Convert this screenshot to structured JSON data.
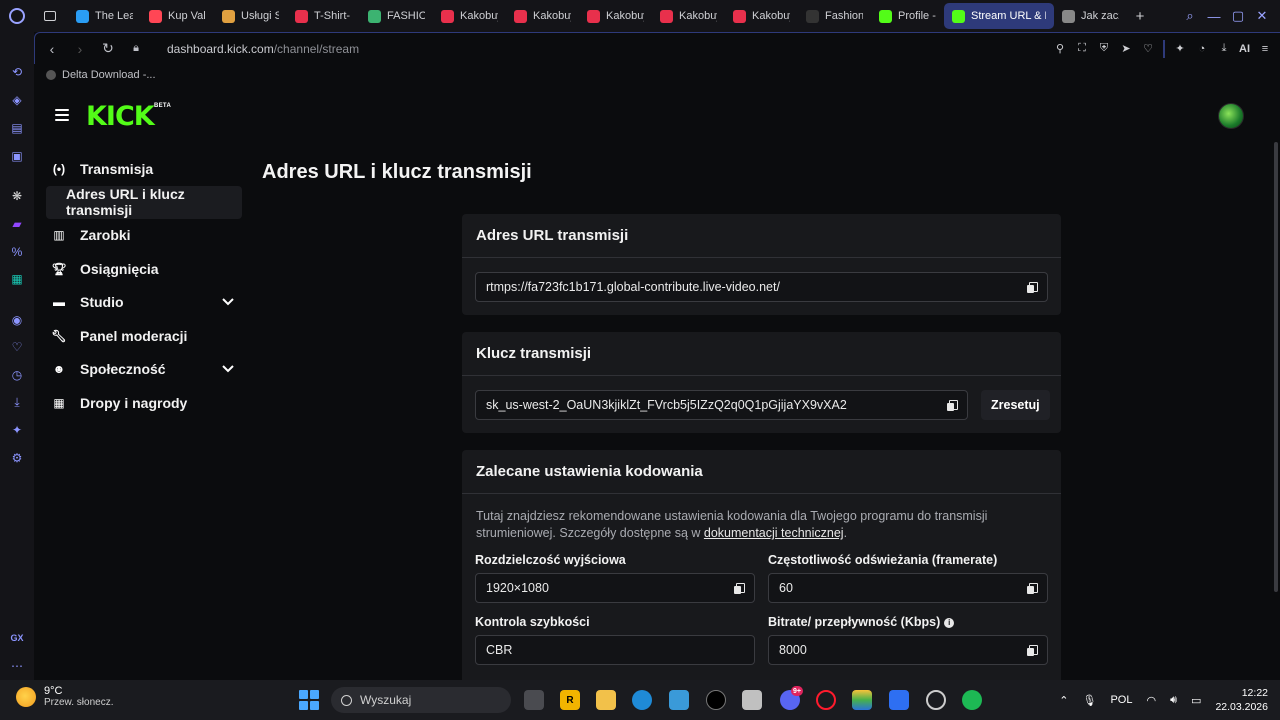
{
  "browser": {
    "tabs": [
      {
        "label": "The Leag",
        "color": "#2a9df4"
      },
      {
        "label": "Kup Valo",
        "color": "#ff4655"
      },
      {
        "label": "Usługi S",
        "color": "#e0a040"
      },
      {
        "label": "T-Shirt-",
        "color": "#e8304c"
      },
      {
        "label": "FASHION",
        "color": "#3cb371"
      },
      {
        "label": "Kakobuy",
        "color": "#e8304c"
      },
      {
        "label": "Kakobuy",
        "color": "#e8304c"
      },
      {
        "label": "Kakobuy",
        "color": "#e8304c"
      },
      {
        "label": "Kakobuy",
        "color": "#e8304c"
      },
      {
        "label": "Kakobuy",
        "color": "#e8304c"
      },
      {
        "label": "Fashion",
        "color": "#333333"
      },
      {
        "label": "Profile -",
        "color": "#53fc18"
      },
      {
        "label": "Stream URL & K",
        "color": "#53fc18"
      },
      {
        "label": "Jak zacz",
        "color": "#888888"
      }
    ],
    "url_host": "dashboard.kick.com",
    "url_path": "/channel/stream",
    "bookmark": "Delta Download -...",
    "ai_label": "AI"
  },
  "kick": {
    "logo": "KICK",
    "beta": "BETA",
    "nav": {
      "transmisja": "Transmisja",
      "sub_active": "Adres URL i klucz transmisji",
      "zarobki": "Zarobki",
      "osiagniecia": "Osiągnięcia",
      "studio": "Studio",
      "panel": "Panel moderacji",
      "spolecznosc": "Społeczność",
      "dropy": "Dropy i nagrody"
    },
    "page_title": "Adres URL i klucz transmisji",
    "url_card": {
      "title": "Adres URL transmisji",
      "value": "rtmps://fa723fc1b171.global-contribute.live-video.net/"
    },
    "key_card": {
      "title": "Klucz transmisji",
      "value": "sk_us-west-2_OaUN3kjiklZt_FVrcb5j5IZzQ2q0Q1pGjijaYX9vXA2",
      "reset": "Zresetuj"
    },
    "encoding_card": {
      "title": "Zalecane ustawienia kodowania",
      "desc_1": "Tutaj znajdziesz rekomendowane ustawienia kodowania dla Twojego programu do transmisji strumieniowej. Szczegóły dostępne są w ",
      "desc_link": "dokumentacji technicznej",
      "desc_2": ".",
      "resolution_label": "Rozdzielczość wyjściowa",
      "resolution_value": "1920×1080",
      "framerate_label": "Częstotliwość odświeżania (framerate)",
      "framerate_value": "60",
      "rate_label": "Kontrola szybkości",
      "rate_value": "CBR",
      "bitrate_label": "Bitrate/ przepływność (Kbps)",
      "bitrate_value": "8000"
    }
  },
  "taskbar": {
    "temp": "9°C",
    "weather": "Przew. słonecz.",
    "search": "Wyszukaj",
    "lang": "POL",
    "time": "12:22",
    "date": "22.03.2026",
    "badge": "9+"
  }
}
